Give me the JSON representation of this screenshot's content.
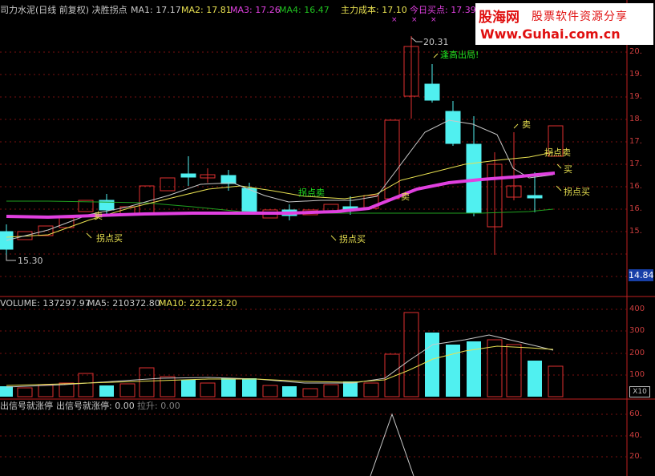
{
  "header": {
    "stock_title": "司力水泥(日线 前复权) 决胜拐点",
    "ma1": "MA1: 17.17",
    "ma2": "MA2: 17.81",
    "ma3": "MA3: 17.26",
    "ma4": "MA4: 16.47",
    "main_cost": "主力成本: 17.10",
    "buy_today": "今日买点: 17.39"
  },
  "watermark": {
    "brand": "股海网",
    "slogan": "股票软件资源分享",
    "url": "Www.Guhai.com.cn"
  },
  "price_axis": {
    "labels": [
      "20.",
      "19.",
      "19.",
      "18.",
      "17.",
      "17.",
      "16.",
      "16.",
      "15."
    ],
    "current_price": "14.84"
  },
  "annotations": {
    "high": "20.31",
    "low": "15.30",
    "break_high": "逢高出局!",
    "sell_1": "卖",
    "sell_2": "卖",
    "sell_3": "卖",
    "buy_1": "买",
    "turn_sell_1": "拐点卖",
    "turn_sell_2": "拐点卖",
    "turn_buy_1": "拐点买",
    "turn_buy_2": "拐点买",
    "turn_buy_3": "拐点买"
  },
  "volume_panel": {
    "volume": "VOLUME: 137297.97",
    "ma5": "MA5: 210372.80",
    "ma10": "MA10: 221223.20",
    "axis": [
      "400",
      "300",
      "200",
      "100"
    ],
    "unit": "X10"
  },
  "indicator_panel": {
    "name": "出信号就涨停",
    "value_label": "出信号就涨停: 0.00",
    "rise_label": "拉升: 0.00",
    "axis": [
      "60.",
      "40.",
      "20."
    ]
  },
  "colors": {
    "up_candle": "#e03030",
    "down_candle": "#50f0f0",
    "ma1": "#c8c8c8",
    "ma2": "#e8e050",
    "ma3": "#e040e0",
    "ma4": "#20a020",
    "main_cost_line": "#e040e0",
    "grid": "#8a1010"
  }
}
